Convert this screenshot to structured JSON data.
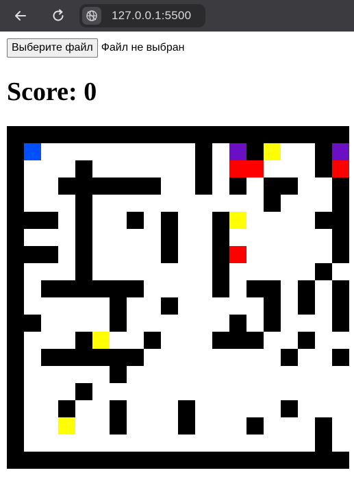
{
  "browser": {
    "url": "127.0.0.1:5500",
    "back_icon": "arrow-left-icon",
    "reload_icon": "reload-icon",
    "site_icon": "globe-icon"
  },
  "file_input": {
    "button_label": "Выберите файл",
    "status": "Файл не выбран"
  },
  "score": {
    "text": "Score: 0"
  },
  "maze": {
    "legend": {
      "#": "wall (#000000)",
      ".": "path (#ffffff)",
      "B": "player (#0050ff)",
      "P": "purple (#6a0fc4)",
      "R": "red (#ff0000)",
      "Y": "yellow (#ffff00)"
    },
    "colors": {
      "wall": "#000000",
      "path": "#ffffff",
      "player": "#0050ff",
      "purple": "#6a0fc4",
      "red": "#ff0000",
      "yellow": "#ffff00"
    },
    "rows": [
      "####################",
      "#B.........#.P#Y..#PP",
      "#...#......#.RR...#R#",
      "#..######..#.#.##..#",
      "#...#..........#...#",
      "###.#..#.#..#Y....##",
      "#...#....#..#......#",
      "###.#....#..#R.....#",
      "#...#.......#.....#.",
      "#.######....#.##.#.#",
      "#.....#..#.....#.#.#",
      "##....#......#.#...#",
      "#...#Y..#...###..#..",
      "#.######........#..#",
      "#.....#.............#",
      "#...#................",
      "#..#..#...#.....#...#",
      "#..Y..#...#...#...#.#",
      "#.................#.#",
      "####################"
    ]
  }
}
